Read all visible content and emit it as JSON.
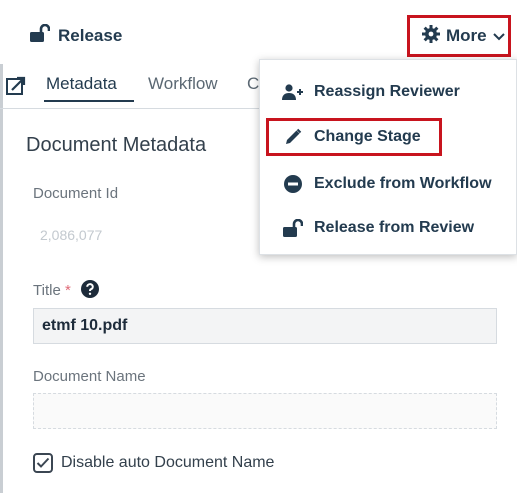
{
  "toolbar": {
    "release_label": "Release",
    "more_label": "More"
  },
  "tabs": [
    {
      "label": "Metadata",
      "active": true
    },
    {
      "label": "Workflow",
      "active": false
    },
    {
      "label": "C",
      "active": false
    }
  ],
  "section": {
    "title": "Document Metadata"
  },
  "fields": {
    "document_id": {
      "label": "Document Id",
      "value": "2,086,077"
    },
    "title": {
      "label": "Title",
      "required_mark": "*",
      "value": "etmf 10.pdf"
    },
    "document_name": {
      "label": "Document Name",
      "value": ""
    },
    "disable_auto_name": {
      "label": "Disable auto Document Name",
      "checked": true
    }
  },
  "more_menu": {
    "items": [
      {
        "label": "Reassign Reviewer",
        "icon": "user-plus-icon"
      },
      {
        "label": "Change Stage",
        "icon": "pencil-icon",
        "highlighted": true
      },
      {
        "label": "Exclude from Workflow",
        "icon": "minus-circle-icon"
      },
      {
        "label": "Release from Review",
        "icon": "unlock-icon"
      }
    ]
  },
  "colors": {
    "highlight_border": "#c8141e",
    "text_primary": "#233b4f"
  }
}
